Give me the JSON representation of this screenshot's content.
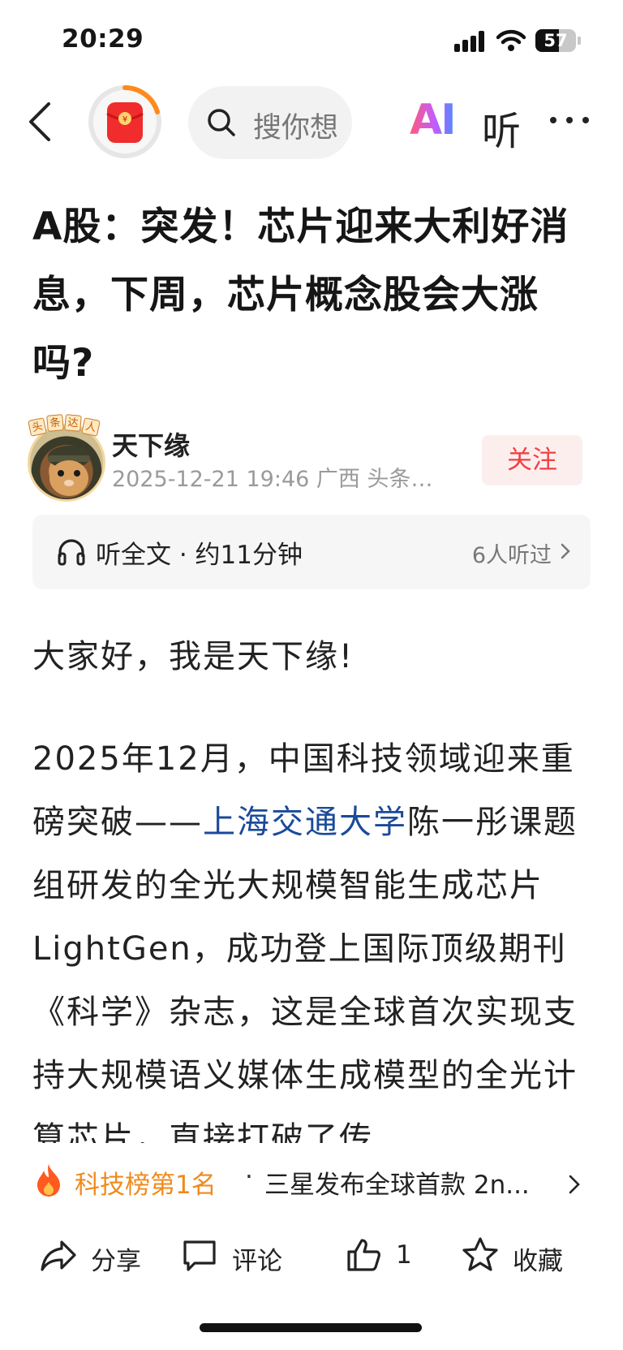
{
  "status_bar": {
    "time": "20:29",
    "battery": "57",
    "battery_level": 0.57
  },
  "nav": {
    "search_placeholder": "搜你想",
    "ai_label": "AI",
    "listen_label": "听"
  },
  "article": {
    "title": "A股：突发！芯片迎来大利好消息，下周，芯片概念股会大涨吗?",
    "author": {
      "name": "天下缘",
      "meta": "2025-12-21 19:46 广西  头条…",
      "badge_chars": [
        "头",
        "条",
        "达",
        "人"
      ],
      "follow_label": "关注"
    },
    "listen_bar": {
      "label": "听全文 · 约11分钟",
      "count": "6人听过"
    },
    "greeting": "大家好，我是天下缘!",
    "body": {
      "part1": "2025年12月，中国科技领域迎来重磅突破——",
      "link": "上海交通大学",
      "part2": "陈一彤课题组研发的全光大规模智能生成芯片LightGen，成功登上国际顶级期刊《科学》杂志，这是全球首次实现支持大规模语义媒体生成模型的全光计算芯片，直接打破了传"
    }
  },
  "trend": {
    "rank": "科技榜第1名",
    "dot": "·",
    "news": "三星发布全球首款 2n..."
  },
  "actions": {
    "share": "分享",
    "comment": "评论",
    "like_count": "1",
    "favorite": "收藏"
  },
  "colors": {
    "accent_red": "#f04142",
    "trend_orange": "#f08a1c",
    "link_blue": "#1a4a9a"
  }
}
